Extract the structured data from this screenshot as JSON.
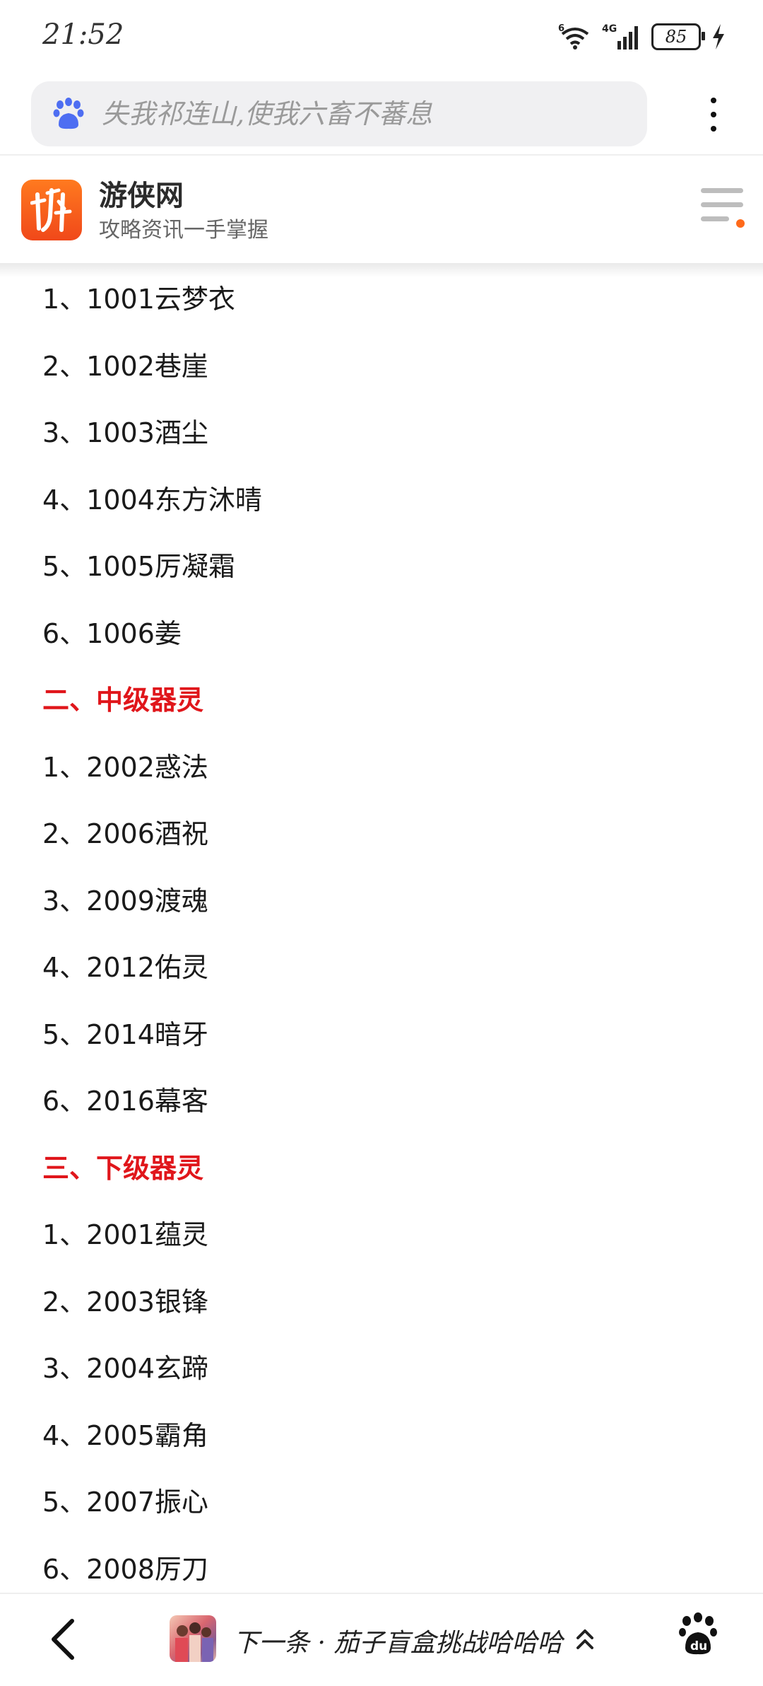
{
  "status_bar": {
    "time": "21:52",
    "battery": "85",
    "network": "4G",
    "wifi_sub": "6"
  },
  "search": {
    "placeholder": "失我祁连山,使我六畜不蕃息"
  },
  "site": {
    "name": "游侠网",
    "slogan": "攻略资讯一手掌握",
    "accent": "#ff6a1a"
  },
  "content": {
    "heading_color": "#e0161b",
    "list_top": [
      "1、1001云梦衣",
      "2、1002巷崖",
      "3、1003酒尘",
      "4、1004东方沐晴",
      "5、1005厉凝霜",
      "6、1006姜"
    ],
    "section2_title": "二、中级器灵",
    "list_mid": [
      "1、2002惑法",
      "2、2006酒祝",
      "3、2009渡魂",
      "4、2012佑灵",
      "5、2014暗牙",
      "6、2016幕客"
    ],
    "section3_title": "三、下级器灵",
    "list_low": [
      "1、2001蕴灵",
      "2、2003银锋",
      "3、2004玄蹄",
      "4、2005霸角",
      "5、2007振心",
      "6、2008厉刀"
    ]
  },
  "bottom_bar": {
    "next_text": "下一条 · 茄子盲盒挑战哈哈哈"
  }
}
